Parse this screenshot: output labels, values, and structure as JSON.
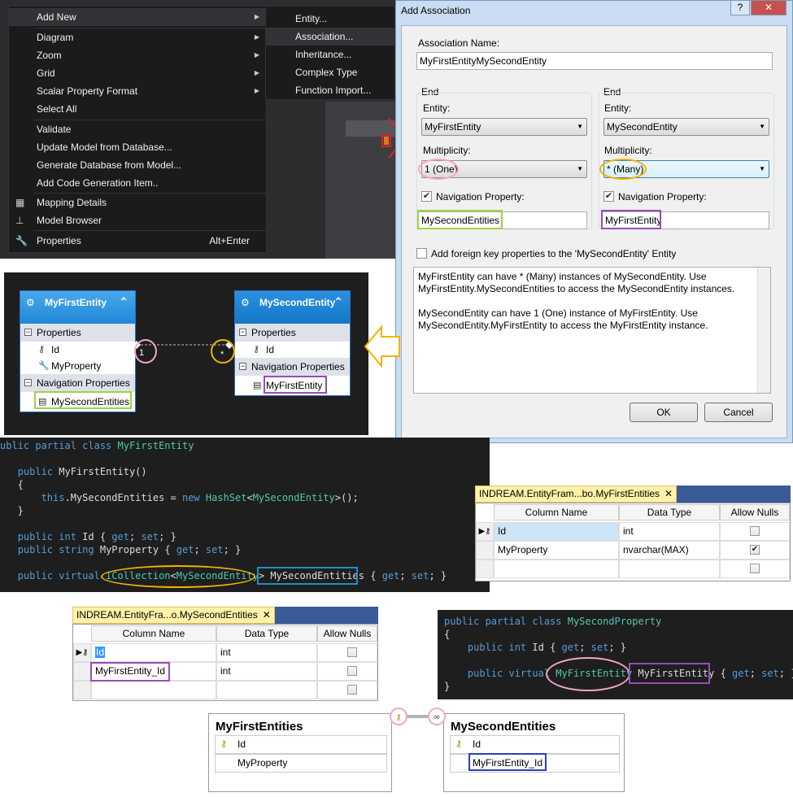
{
  "context_menu": {
    "items": [
      {
        "label": "Add New",
        "submenu": true
      },
      {
        "label": "Diagram",
        "submenu": true
      },
      {
        "label": "Zoom",
        "submenu": true
      },
      {
        "label": "Grid",
        "submenu": true
      },
      {
        "label": "Scalar Property Format",
        "submenu": true
      },
      {
        "label": "Select All"
      },
      {
        "label": "Validate"
      },
      {
        "label": "Update Model from Database..."
      },
      {
        "label": "Generate Database from Model..."
      },
      {
        "label": "Add Code Generation Item.."
      },
      {
        "label": "Mapping Details",
        "icon": "mapping-details-icon"
      },
      {
        "label": "Model Browser",
        "icon": "model-browser-icon"
      },
      {
        "label": "Properties",
        "icon": "properties-wrench-icon",
        "shortcut": "Alt+Enter"
      }
    ],
    "submenu": [
      "Entity...",
      "Association...",
      "Inheritance...",
      "Complex Type",
      "Function Import..."
    ]
  },
  "dialog": {
    "title": "Add Association",
    "help_btn": "?",
    "close_btn": "✕",
    "association_name_label": "Association Name:",
    "association_name": "MyFirstEntityMySecondEntity",
    "end1": {
      "group": "End",
      "entity_label": "Entity:",
      "entity": "MyFirstEntity",
      "multiplicity_label": "Multiplicity:",
      "multiplicity": "1 (One)",
      "nav_label": "Navigation Property:",
      "nav_checked": true,
      "nav_value": "MySecondEntities"
    },
    "end2": {
      "group": "End",
      "entity_label": "Entity:",
      "entity": "MySecondEntity",
      "multiplicity_label": "Multiplicity:",
      "multiplicity": "* (Many)",
      "nav_label": "Navigation Property:",
      "nav_checked": true,
      "nav_value": "MyFirstEntity"
    },
    "fk_label": "Add foreign key properties to the 'MySecondEntity' Entity",
    "fk_checked": false,
    "description": [
      "MyFirstEntity can have * (Many) instances of MySecondEntity. Use MyFirstEntity.MySecondEntities to access the MySecondEntity instances.",
      "MySecondEntity can have 1 (One) instance of MyFirstEntity. Use MySecondEntity.MyFirstEntity to access the MyFirstEntity instance."
    ],
    "ok": "OK",
    "cancel": "Cancel"
  },
  "entity_diagram": {
    "entity1": {
      "name": "MyFirstEntity",
      "sections": [
        {
          "title": "Properties",
          "rows": [
            "Id",
            "MyProperty"
          ]
        },
        {
          "title": "Navigation Properties",
          "rows": [
            "MySecondEntities"
          ]
        }
      ]
    },
    "entity2": {
      "name": "MySecondEntity",
      "sections": [
        {
          "title": "Properties",
          "rows": [
            "Id"
          ]
        },
        {
          "title": "Navigation Properties",
          "rows": [
            "MyFirstEntity"
          ]
        }
      ]
    },
    "mult1": "1",
    "mult2": "*"
  },
  "code1": [
    "ublic partial class MyFirstEntity",
    "",
    "   public MyFirstEntity()",
    "   {",
    "       this.MySecondEntities = new HashSet<MySecondEntity>();",
    "   }",
    "",
    "   public int Id { get; set; }",
    "   public string MyProperty { get; set; }",
    "",
    "   public virtual ICollection<MySecondEntity> MySecondEntities { get; set; }"
  ],
  "code2": [
    "public partial class MySecondProperty",
    "{",
    "    public int Id { get; set; }",
    "",
    "    public virtual MyFirstEntity MyFirstEntity { get; set; }",
    "}"
  ],
  "table1": {
    "tab": "INDREAM.EntityFram...bo.MyFirstEntities",
    "close": "✕",
    "headers": [
      "Column Name",
      "Data Type",
      "Allow Nulls"
    ],
    "rows": [
      {
        "name": "Id",
        "type": "int",
        "nulls": false,
        "key": true
      },
      {
        "name": "MyProperty",
        "type": "nvarchar(MAX)",
        "nulls": true
      },
      {
        "name": "",
        "type": "",
        "nulls": false
      }
    ]
  },
  "table2": {
    "tab": "INDREAM.EntityFra...o.MySecondEntities",
    "close": "✕",
    "headers": [
      "Column Name",
      "Data Type",
      "Allow Nulls"
    ],
    "rows": [
      {
        "name": "Id",
        "type": "int",
        "nulls": false,
        "key": true
      },
      {
        "name": "MyFirstEntity_Id",
        "type": "int",
        "nulls": false
      },
      {
        "name": "",
        "type": "",
        "nulls": false
      }
    ]
  },
  "db_diagram": {
    "table1": {
      "title": "MyFirstEntities",
      "rows": [
        "Id",
        "MyProperty"
      ]
    },
    "table2": {
      "title": "MySecondEntities",
      "rows": [
        "Id",
        "MyFirstEntity_Id"
      ]
    }
  },
  "colors": {
    "pink": "#f4a6c8",
    "yellow": "#f0b400",
    "green": "#a0d23c",
    "purple": "#9b4bb4",
    "blue": "#1e90c8",
    "navy": "#2a3fbf",
    "red": "#e02020",
    "entity_header": "#1e88d8",
    "entity_header_light": "#4aa8ec"
  }
}
